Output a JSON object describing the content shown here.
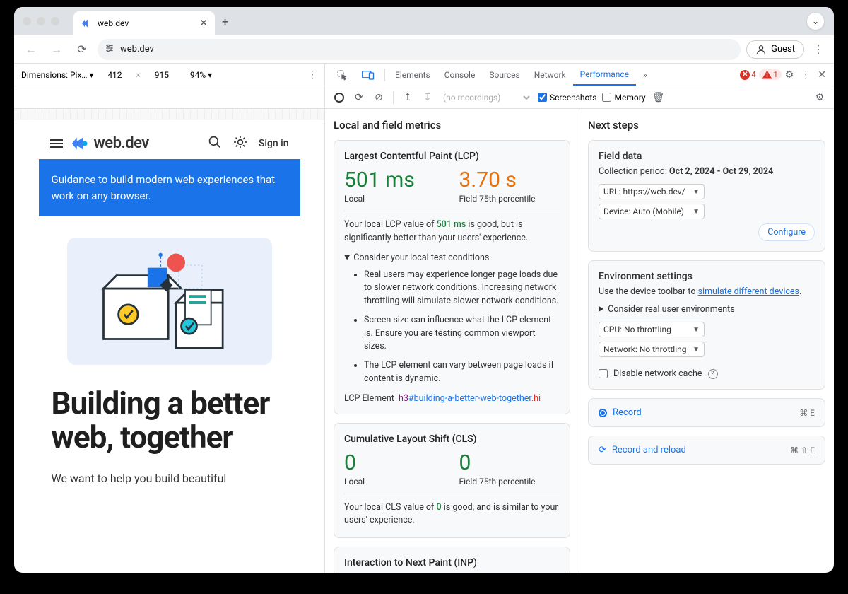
{
  "browser": {
    "tab_title": "web.dev",
    "url": "web.dev",
    "guest_label": "Guest"
  },
  "device_toolbar": {
    "dimensions_label": "Dimensions: Pix…",
    "width": "412",
    "height": "915",
    "zoom": "94%"
  },
  "devtools": {
    "tabs": {
      "elements": "Elements",
      "console": "Console",
      "sources": "Sources",
      "network": "Network",
      "performance": "Performance"
    },
    "error_count": "4",
    "warn_count": "1"
  },
  "perf_toolbar": {
    "recordings_placeholder": "(no recordings)",
    "screenshots": "Screenshots",
    "memory": "Memory"
  },
  "page": {
    "brand": "web.dev",
    "signin": "Sign in",
    "banner": "Guidance to build modern web experiences that work on any browser.",
    "headline": "Building a better web, together",
    "subhead": "We want to help you build beautiful"
  },
  "metrics": {
    "heading": "Local and field metrics",
    "lcp": {
      "title": "Largest Contentful Paint (LCP)",
      "local_value": "501 ms",
      "local_label": "Local",
      "field_value": "3.70 s",
      "field_label": "Field 75th percentile",
      "note_pre": "Your local LCP value of ",
      "note_val": "501 ms",
      "note_post": " is good, but is significantly better than your users' experience.",
      "consider": "Consider your local test conditions",
      "bullets": [
        "Real users may experience longer page loads due to slower network conditions. Increasing network throttling will simulate slower network conditions.",
        "Screen size can influence what the LCP element is. Ensure you are testing common viewport sizes.",
        "The LCP element can vary between page loads if content is dynamic."
      ],
      "element_label": "LCP Element",
      "element_tag": "h3",
      "element_id": "#building-a-better-web-together",
      "element_trail": ".hi"
    },
    "cls": {
      "title": "Cumulative Layout Shift (CLS)",
      "local_value": "0",
      "local_label": "Local",
      "field_value": "0",
      "field_label": "Field 75th percentile",
      "note_pre": "Your local CLS value of ",
      "note_val": "0",
      "note_post": " is good, and is similar to your users' experience."
    },
    "inp": {
      "title": "Interaction to Next Paint (INP)"
    }
  },
  "steps": {
    "heading": "Next steps",
    "field": {
      "title": "Field data",
      "period_label": "Collection period: ",
      "period_value": "Oct 2, 2024 - Oct 29, 2024",
      "url_select": "URL: https://web.dev/",
      "device_select": "Device: Auto (Mobile)",
      "configure": "Configure"
    },
    "env": {
      "title": "Environment settings",
      "hint_pre": "Use the device toolbar to ",
      "hint_link": "simulate different devices",
      "consider": "Consider real user environments",
      "cpu_select": "CPU: No throttling",
      "net_select": "Network: No throttling",
      "disable_cache": "Disable network cache"
    },
    "record": {
      "label": "Record",
      "shortcut": "⌘ E"
    },
    "record_reload": {
      "label": "Record and reload",
      "shortcut": "⌘ ⇧ E"
    }
  }
}
